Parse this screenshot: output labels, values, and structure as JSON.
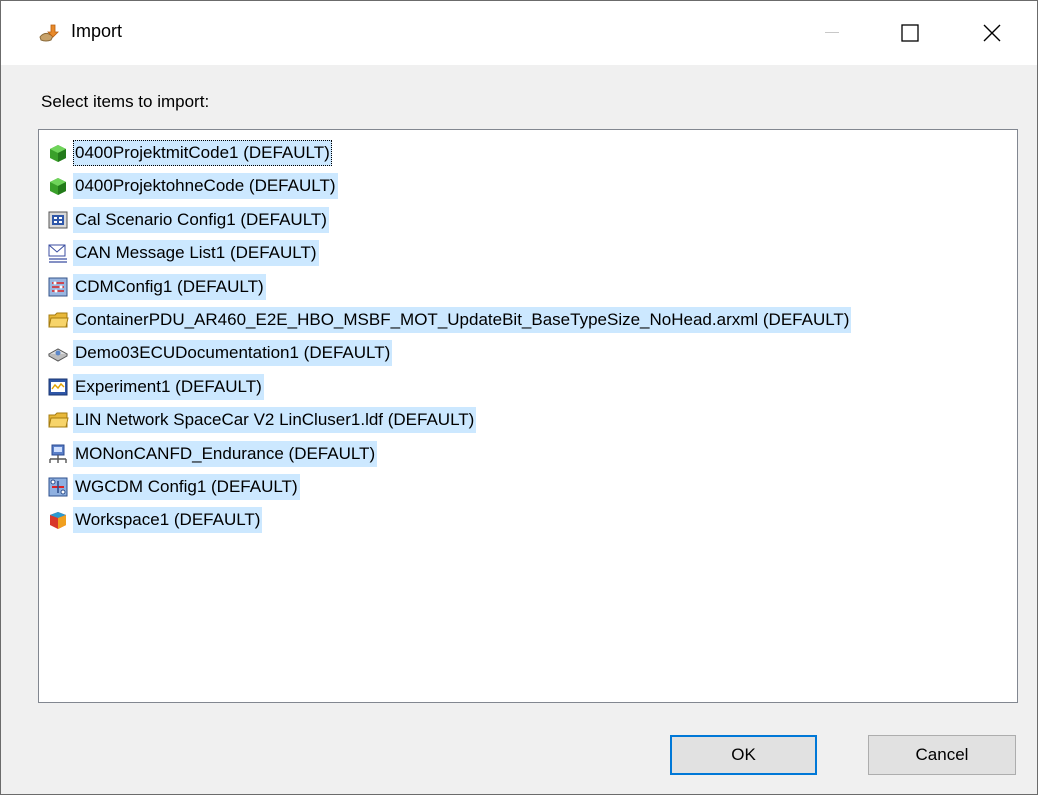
{
  "window": {
    "title": "Import",
    "controls": {
      "minimize": "minimize-icon",
      "maximize": "maximize-icon",
      "close": "close-icon"
    }
  },
  "prompt": "Select items to import:",
  "items": [
    {
      "label": "0400ProjektmitCode1 (DEFAULT)",
      "icon": "project-icon",
      "selected": true,
      "focused": true
    },
    {
      "label": "0400ProjektohneCode (DEFAULT)",
      "icon": "project-icon",
      "selected": true
    },
    {
      "label": "Cal Scenario Config1 (DEFAULT)",
      "icon": "cal-scenario-icon",
      "selected": true
    },
    {
      "label": "CAN Message List1 (DEFAULT)",
      "icon": "message-list-icon",
      "selected": true
    },
    {
      "label": "CDMConfig1 (DEFAULT)",
      "icon": "cdm-config-icon",
      "selected": true
    },
    {
      "label": "ContainerPDU_AR460_E2E_HBO_MSBF_MOT_UpdateBit_BaseTypeSize_NoHead.arxml (DEFAULT)",
      "icon": "folder-icon",
      "selected": true
    },
    {
      "label": "Demo03ECUDocumentation1 (DEFAULT)",
      "icon": "documentation-icon",
      "selected": true
    },
    {
      "label": "Experiment1 (DEFAULT)",
      "icon": "experiment-icon",
      "selected": true
    },
    {
      "label": "LIN Network SpaceCar V2 LinCluser1.ldf (DEFAULT)",
      "icon": "folder-icon",
      "selected": true
    },
    {
      "label": "MONonCANFD_Endurance (DEFAULT)",
      "icon": "network-icon",
      "selected": true
    },
    {
      "label": "WGCDM Config1 (DEFAULT)",
      "icon": "wgcdm-icon",
      "selected": true
    },
    {
      "label": "Workspace1 (DEFAULT)",
      "icon": "workspace-icon",
      "selected": true
    }
  ],
  "buttons": {
    "ok": "OK",
    "cancel": "Cancel"
  },
  "colors": {
    "selection": "#cce8ff",
    "default_button_border": "#0078d7"
  }
}
